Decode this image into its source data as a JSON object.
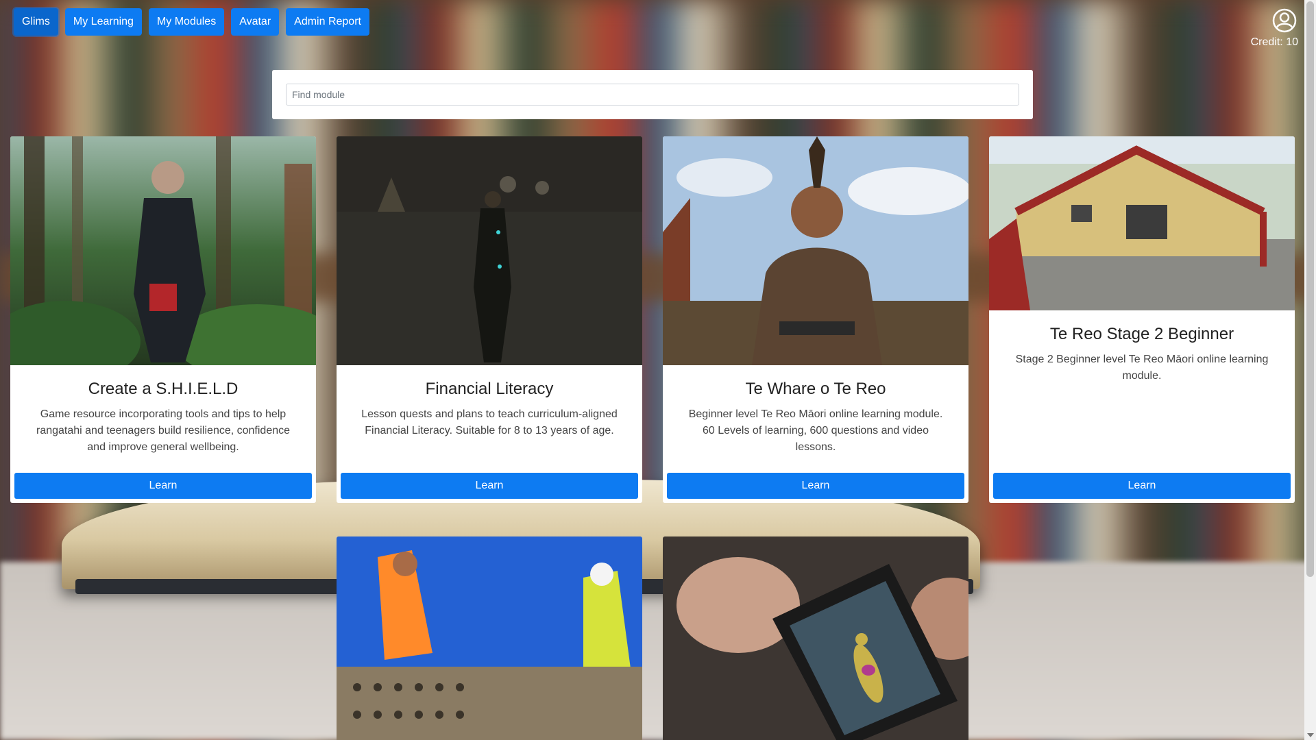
{
  "nav": {
    "items": [
      {
        "label": "Glims"
      },
      {
        "label": "My Learning"
      },
      {
        "label": "My Modules"
      },
      {
        "label": "Avatar"
      },
      {
        "label": "Admin Report"
      }
    ]
  },
  "account": {
    "icon": "user-circle-icon",
    "credit_label": "Credit: 10"
  },
  "search": {
    "placeholder": "Find module",
    "value": ""
  },
  "modules": [
    {
      "title": "Create a S.H.I.E.L.D",
      "description": "Game resource incorporating tools and tips to help rangatahi and teenagers build resilience, confidence and improve general wellbeing.",
      "button": "Learn",
      "image": "armored-hero-in-jungle"
    },
    {
      "title": "Financial Literacy",
      "description": "Lesson quests and plans to teach curriculum-aligned Financial Literacy. Suitable for 8 to 13 years of age.",
      "button": "Learn",
      "image": "figure-on-dark-futuristic-road"
    },
    {
      "title": "Te Whare o Te Reo",
      "description": "Beginner level Te Reo Māori online learning module. 60 Levels of learning, 600 questions and video lessons.",
      "button": "Learn",
      "image": "maori-warrior-with-tablet"
    },
    {
      "title": "Te Reo Stage 2 Beginner",
      "description": "Stage 2 Beginner level Te Reo Māori online learning module.",
      "button": "Learn",
      "image": "carved-meeting-house"
    },
    {
      "image": "construction-workers-scaffolding"
    },
    {
      "image": "hands-holding-tablet-anatomy"
    }
  ]
}
